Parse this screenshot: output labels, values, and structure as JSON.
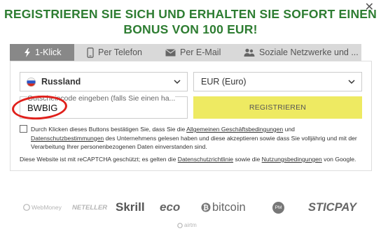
{
  "header": {
    "title_line1": "REGISTRIEREN SIE SICH UND ERHALTEN SIE SOFORT EINEN",
    "title_line2": "BONUS VON 100 EUR!",
    "close_icon": "close-icon"
  },
  "tabs": [
    {
      "label": "1-Klick",
      "icon": "lightning-icon",
      "active": true
    },
    {
      "label": "Per Telefon",
      "icon": "phone-icon",
      "active": false
    },
    {
      "label": "Per E-Mail",
      "icon": "envelope-icon",
      "active": false
    },
    {
      "label": "Soziale Netzwerke und ...",
      "icon": "people-icon",
      "active": false
    }
  ],
  "form": {
    "country_value": "Russland",
    "currency_value": "EUR (Euro)",
    "promo_placeholder": "Gutscheincode eingeben (falls Sie einen ha...",
    "promo_value": "BWBIG",
    "register_label": "REGISTRIEREN"
  },
  "terms": {
    "t1": "Durch Klicken dieses Buttons bestätigen Sie, dass Sie die ",
    "link1": "Allgemeinen Geschäftsbedingungen",
    "t2": " und",
    "link2": "Datenschutzbestimmungen",
    "t3": " des Unternehmens gelesen haben und diese akzeptieren sowie dass Sie volljährig und mit der Verarbeitung Ihrer personenbezogenen Daten einverstanden sind."
  },
  "recaptcha": {
    "t1": "Diese Website ist mit reCAPTCHA geschützt; es gelten die ",
    "link1": "Datenschutzrichtlinie",
    "t2": " sowie die ",
    "link2": "Nutzungsbedingungen",
    "t3": " von Google."
  },
  "payments": {
    "webmoney": "WebMoney",
    "neteller": "NETELLER",
    "skrill": "Skrill",
    "eco": "eco",
    "bitcoin": "bitcoin",
    "pm": "PM",
    "sticpay": "STICPAY",
    "airtm": "airtm"
  },
  "colors": {
    "title_green": "#2e7d32",
    "register_yellow": "#eeea62",
    "highlight_red": "#e0201b",
    "active_tab": "#888888"
  }
}
